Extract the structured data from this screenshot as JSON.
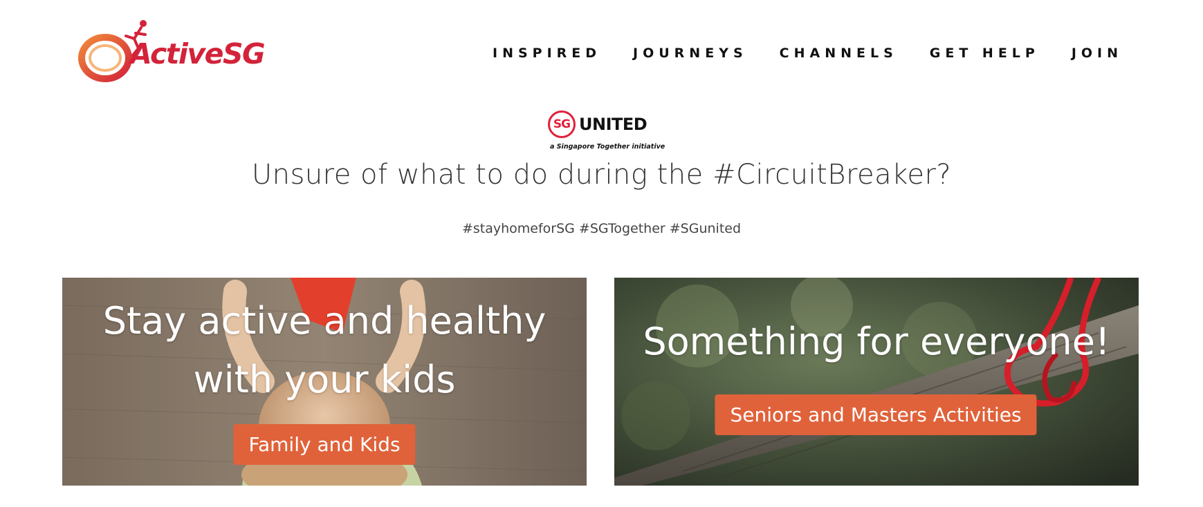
{
  "brand": {
    "logo_text": "ActiveSG",
    "logo_icon": "activesg-ring-runner-icon",
    "accent_color": "#d3233a"
  },
  "nav": {
    "items": [
      {
        "label": "INSPIRED"
      },
      {
        "label": "JOURNEYS"
      },
      {
        "label": "CHANNELS"
      },
      {
        "label": "GET HELP"
      },
      {
        "label": "JOIN"
      }
    ]
  },
  "campaign": {
    "badge_sg": "SG",
    "badge_word": "UNITED",
    "badge_tagline": "a Singapore Together initiative",
    "headline": "Unsure of what to do during the #CircuitBreaker?",
    "hashtags": "#stayhomeforSG #SGTogether #SGunited"
  },
  "cards": [
    {
      "title_line1": "Stay active and healthy",
      "title_line2": "with your kids",
      "button": "Family and Kids",
      "image": "child-reading-on-floor-photo"
    },
    {
      "title": "Something for everyone!",
      "button": "Seniors and Masters Activities",
      "image": "red-rope-heart-knot-on-branch-photo"
    }
  ],
  "button_color": "#e0623a"
}
